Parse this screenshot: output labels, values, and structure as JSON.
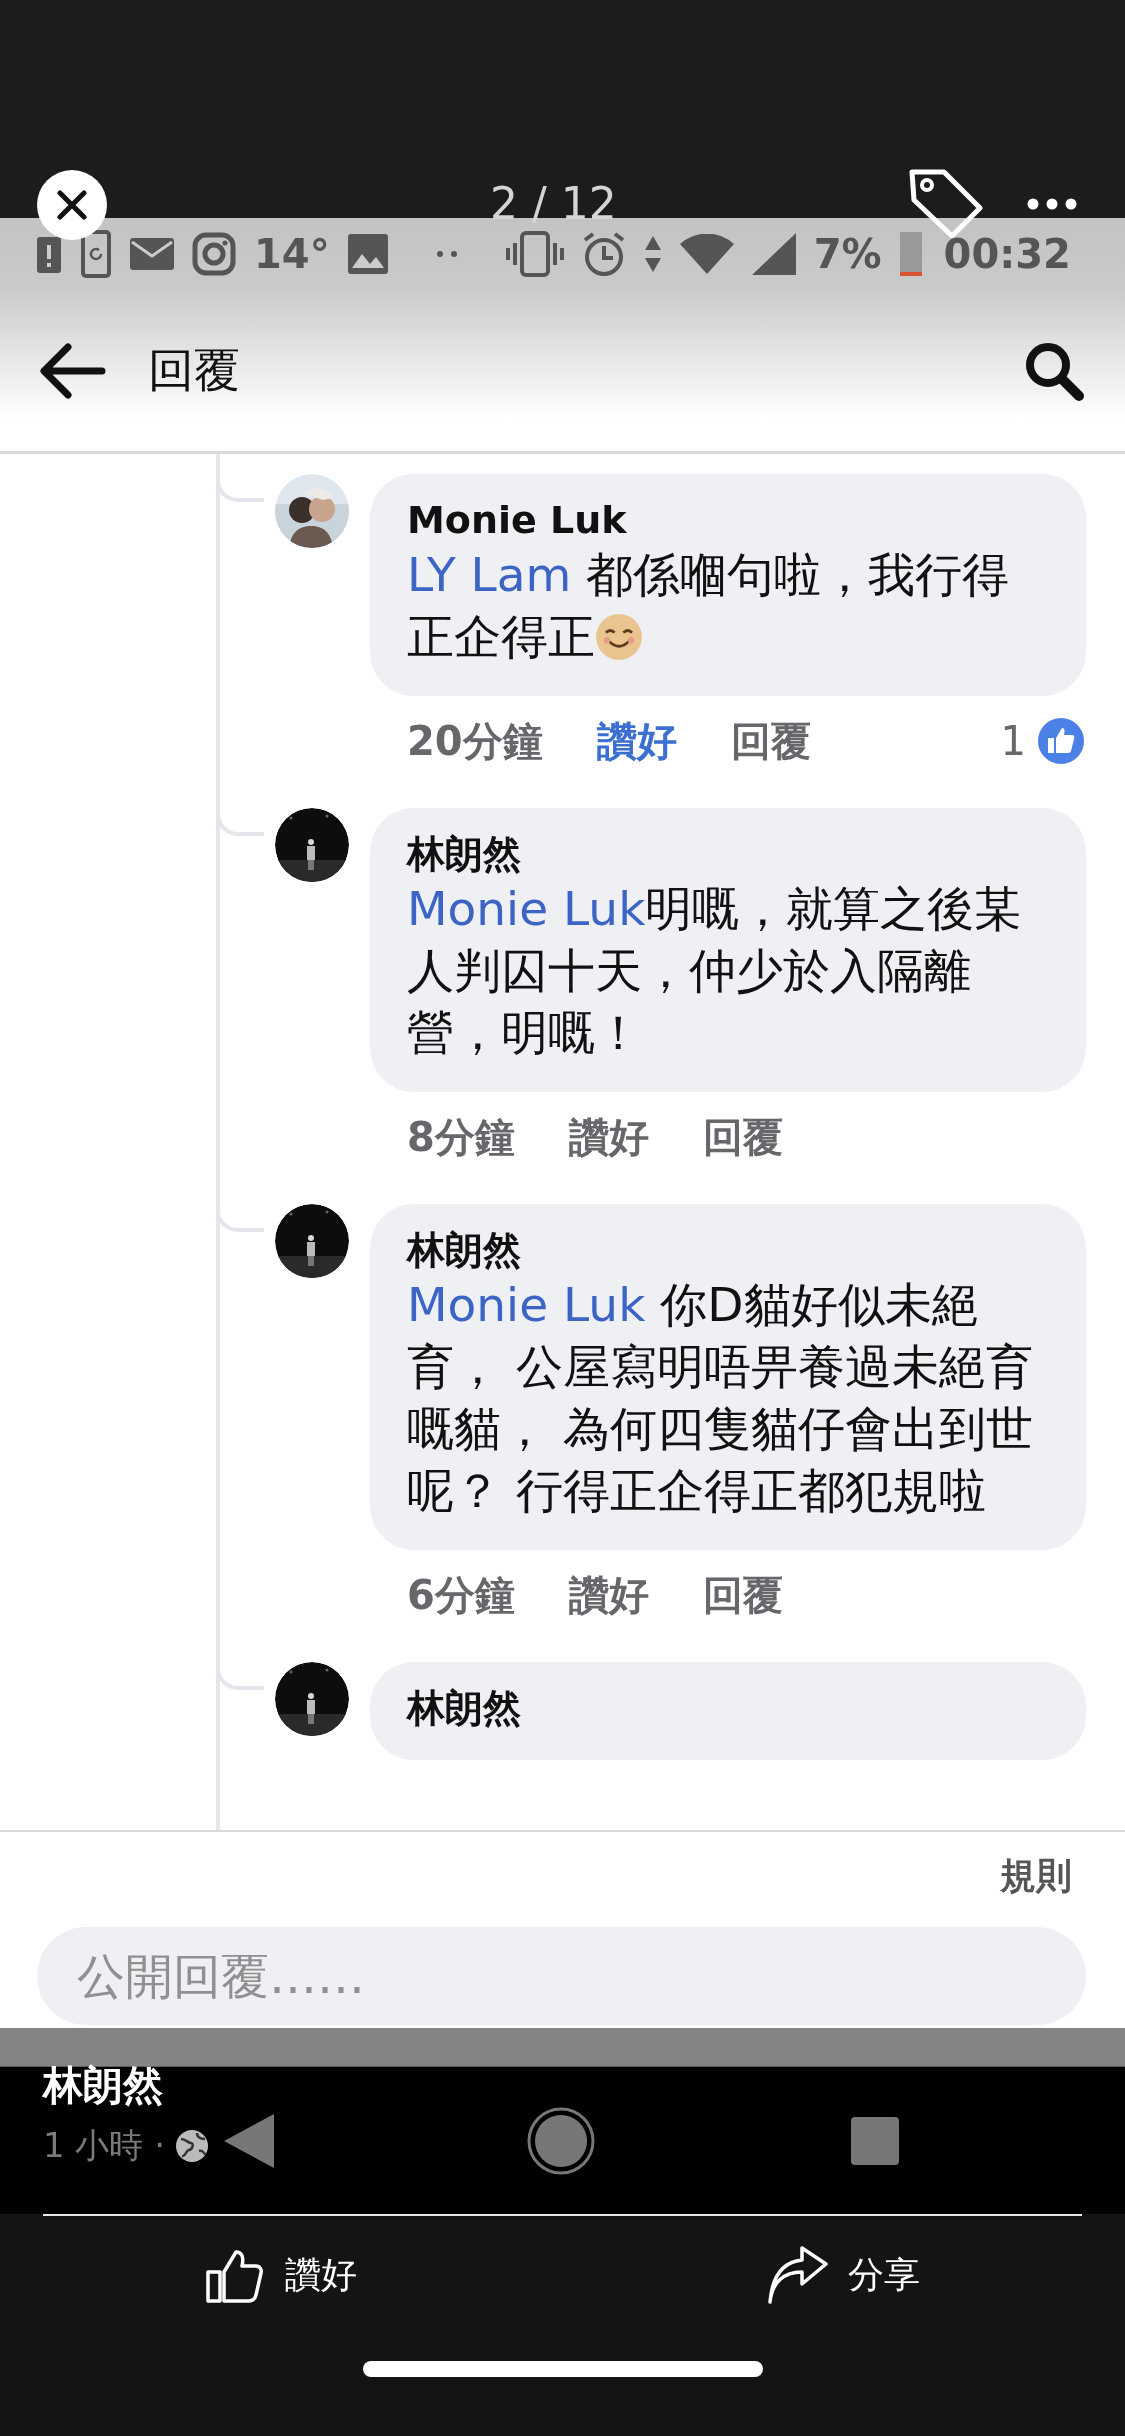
{
  "viewer": {
    "counter": "2 / 12",
    "post_author": "林朗然",
    "post_time": "1 小時 ·",
    "actions": [
      {
        "kind": "like",
        "label": "讚好"
      },
      {
        "kind": "share",
        "label": "分享"
      }
    ]
  },
  "status_bar": {
    "temperature": "14°",
    "battery": "7%",
    "time": "00:32"
  },
  "header": {
    "title": "回覆"
  },
  "comments": [
    {
      "author": "Monie Luk",
      "mention": "LY Lam",
      "text": " 都係嗰句啦，我行得正企得正",
      "emoji": true,
      "time": "20分鐘",
      "like_label": "讚好",
      "liked": true,
      "reply_label": "回覆",
      "reactions": "1"
    },
    {
      "author": "林朗然",
      "mention": "Monie Luk",
      "text": "明嘅，就算之後某人判囚十天，仲少於入隔離營，明嘅！",
      "time": "8分鐘",
      "like_label": "讚好",
      "liked": false,
      "reply_label": "回覆"
    },
    {
      "author": "林朗然",
      "mention": "Monie Luk",
      "text": " 你D貓好似未絕育， 公屋寫明唔畀養過未絕育嘅貓， 為何四隻貓仔會出到世呢？ 行得正企得正都犯規啦",
      "time": "6分鐘",
      "like_label": "讚好",
      "liked": false,
      "reply_label": "回覆"
    },
    {
      "author": "林朗然"
    }
  ],
  "footer": {
    "rules_link": "規則",
    "reply_field": {
      "placeholder": "公開回覆……"
    }
  }
}
